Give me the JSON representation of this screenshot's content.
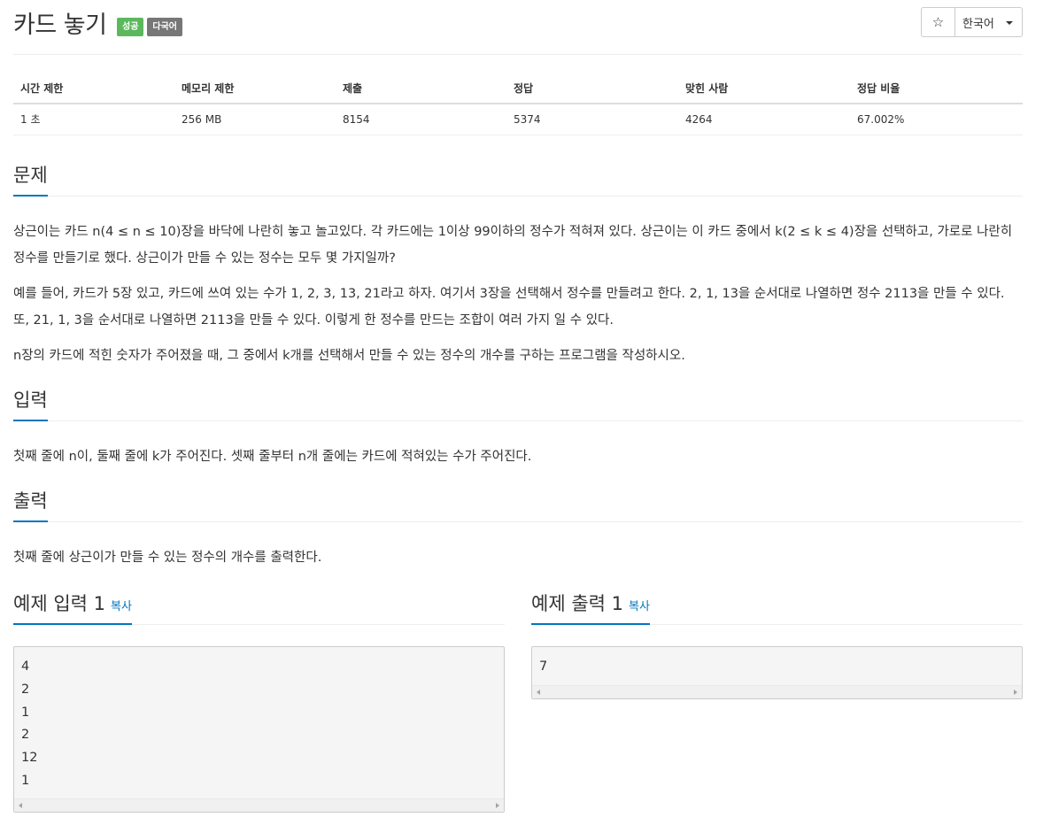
{
  "problem": {
    "title": "카드 놓기",
    "labels": {
      "success": "성공",
      "multilang": "다국어"
    }
  },
  "toolbar": {
    "star_icon": "☆",
    "language": "한국어"
  },
  "info_table": {
    "headers": [
      "시간 제한",
      "메모리 제한",
      "제출",
      "정답",
      "맞힌 사람",
      "정답 비율"
    ],
    "values": [
      "1 초",
      "256 MB",
      "8154",
      "5374",
      "4264",
      "67.002%"
    ]
  },
  "sections": {
    "problem": {
      "title": "문제",
      "paragraphs": [
        "상근이는 카드 n(4 ≤ n ≤ 10)장을 바닥에 나란히 놓고 놀고있다. 각 카드에는 1이상 99이하의 정수가 적혀져 있다. 상근이는 이 카드 중에서 k(2 ≤ k ≤ 4)장을 선택하고, 가로로 나란히 정수를 만들기로 했다. 상근이가 만들 수 있는 정수는 모두 몇 가지일까?",
        "예를 들어, 카드가 5장 있고, 카드에 쓰여 있는 수가 1, 2, 3, 13, 21라고 하자. 여기서 3장을 선택해서 정수를 만들려고 한다. 2, 1, 13을 순서대로 나열하면 정수 2113을 만들 수 있다. 또, 21, 1, 3을 순서대로 나열하면 2113을 만들 수 있다. 이렇게 한 정수를 만드는 조합이 여러 가지 일 수 있다.",
        "n장의 카드에 적힌 숫자가 주어졌을 때, 그 중에서 k개를 선택해서 만들 수 있는 정수의 개수를 구하는 프로그램을 작성하시오."
      ]
    },
    "input": {
      "title": "입력",
      "text": "첫째 줄에 n이, 둘째 줄에 k가 주어진다. 셋째 줄부터 n개 줄에는 카드에 적혀있는 수가 주어진다."
    },
    "output": {
      "title": "출력",
      "text": "첫째 줄에 상근이가 만들 수 있는 정수의 개수를 출력한다."
    }
  },
  "samples": {
    "input": {
      "title": "예제 입력 1",
      "copy": "복사",
      "lines": [
        "4",
        "2",
        "1",
        "2",
        "12",
        "1"
      ]
    },
    "output": {
      "title": "예제 출력 1",
      "copy": "복사",
      "lines": [
        "7"
      ]
    }
  }
}
